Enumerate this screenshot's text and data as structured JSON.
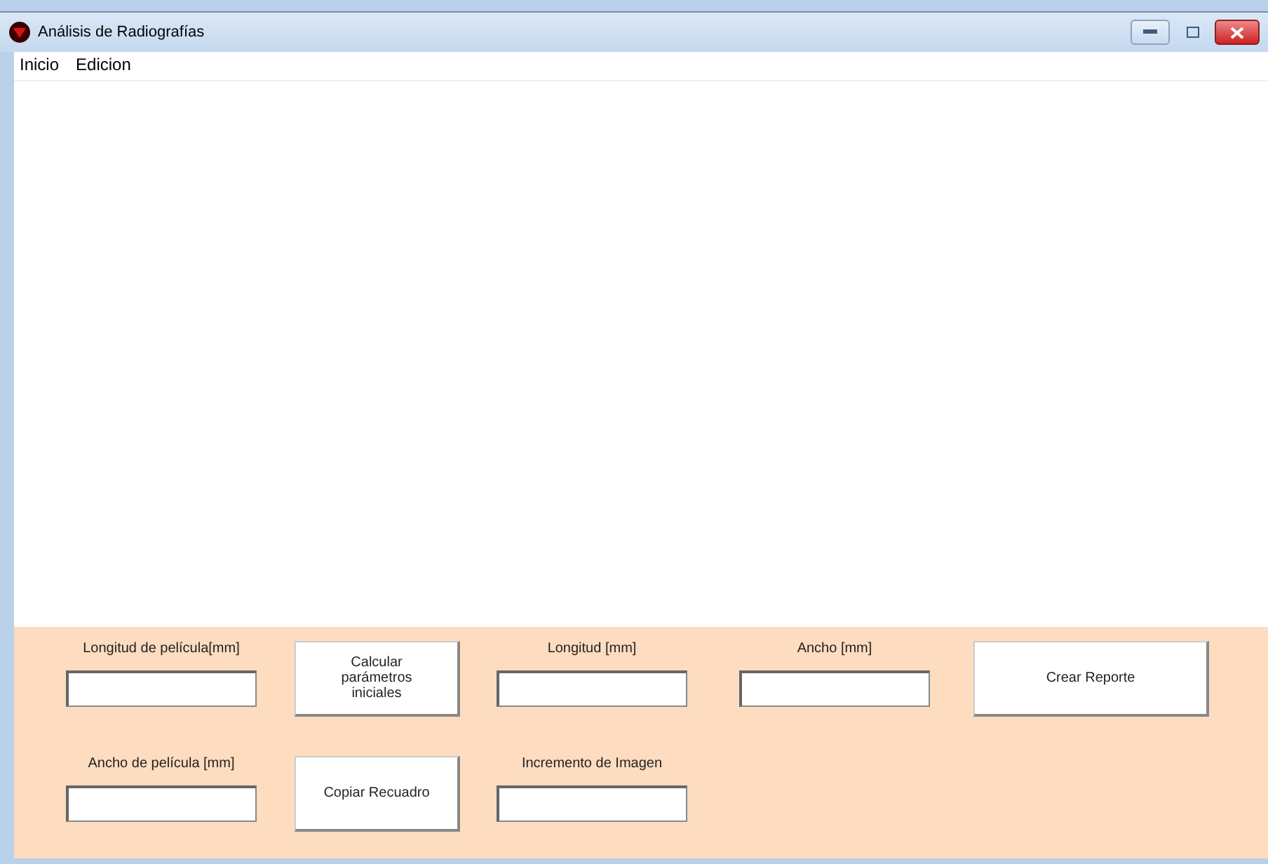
{
  "window": {
    "title": "Análisis de Radiografías"
  },
  "menu": [
    "Inicio",
    "Edicion"
  ],
  "fields": [
    {
      "label": "Longitud de película[mm]"
    },
    {
      "label": "Longitud  [mm]"
    },
    {
      "label": "Ancho  [mm]"
    },
    {
      "label": "Ancho de película [mm]"
    },
    {
      "label": "Incremento de Imagen"
    }
  ],
  "buttons": [
    "Calcular parámetros iniciales",
    "Crear Reporte",
    "Copiar Recuadro"
  ]
}
